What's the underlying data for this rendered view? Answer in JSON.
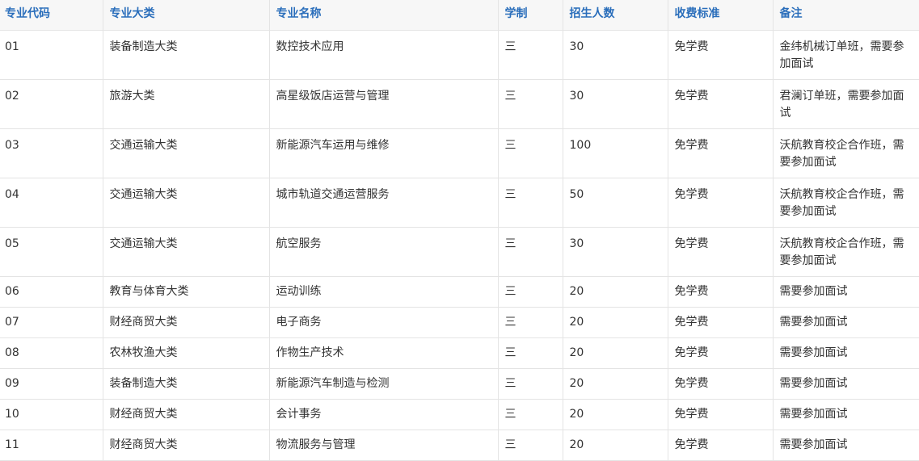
{
  "table": {
    "headers": [
      "专业代码",
      "专业大类",
      "专业名称",
      "学制",
      "招生人数",
      "收费标准",
      "备注"
    ],
    "rows": [
      [
        "01",
        "装备制造大类",
        "数控技术应用",
        "三",
        "30",
        "免学费",
        "金纬机械订单班，需要参加面试"
      ],
      [
        "02",
        "旅游大类",
        "高星级饭店运营与管理",
        "三",
        "30",
        "免学费",
        "君澜订单班，需要参加面试"
      ],
      [
        "03",
        "交通运输大类",
        "新能源汽车运用与维修",
        "三",
        "100",
        "免学费",
        "沃航教育校企合作班，需要参加面试"
      ],
      [
        "04",
        "交通运输大类",
        "城市轨道交通运营服务",
        "三",
        "50",
        "免学费",
        "沃航教育校企合作班，需要参加面试"
      ],
      [
        "05",
        "交通运输大类",
        "航空服务",
        "三",
        "30",
        "免学费",
        "沃航教育校企合作班，需要参加面试"
      ],
      [
        "06",
        "教育与体育大类",
        "运动训练",
        "三",
        "20",
        "免学费",
        "需要参加面试"
      ],
      [
        "07",
        "财经商贸大类",
        "电子商务",
        "三",
        "20",
        "免学费",
        "需要参加面试"
      ],
      [
        "08",
        "农林牧渔大类",
        "作物生产技术",
        "三",
        "20",
        "免学费",
        "需要参加面试"
      ],
      [
        "09",
        "装备制造大类",
        "新能源汽车制造与检测",
        "三",
        "20",
        "免学费",
        "需要参加面试"
      ],
      [
        "10",
        "财经商贸大类",
        "会计事务",
        "三",
        "20",
        "免学费",
        "需要参加面试"
      ],
      [
        "11",
        "财经商贸大类",
        "物流服务与管理",
        "三",
        "20",
        "免学费",
        "需要参加面试"
      ]
    ]
  }
}
